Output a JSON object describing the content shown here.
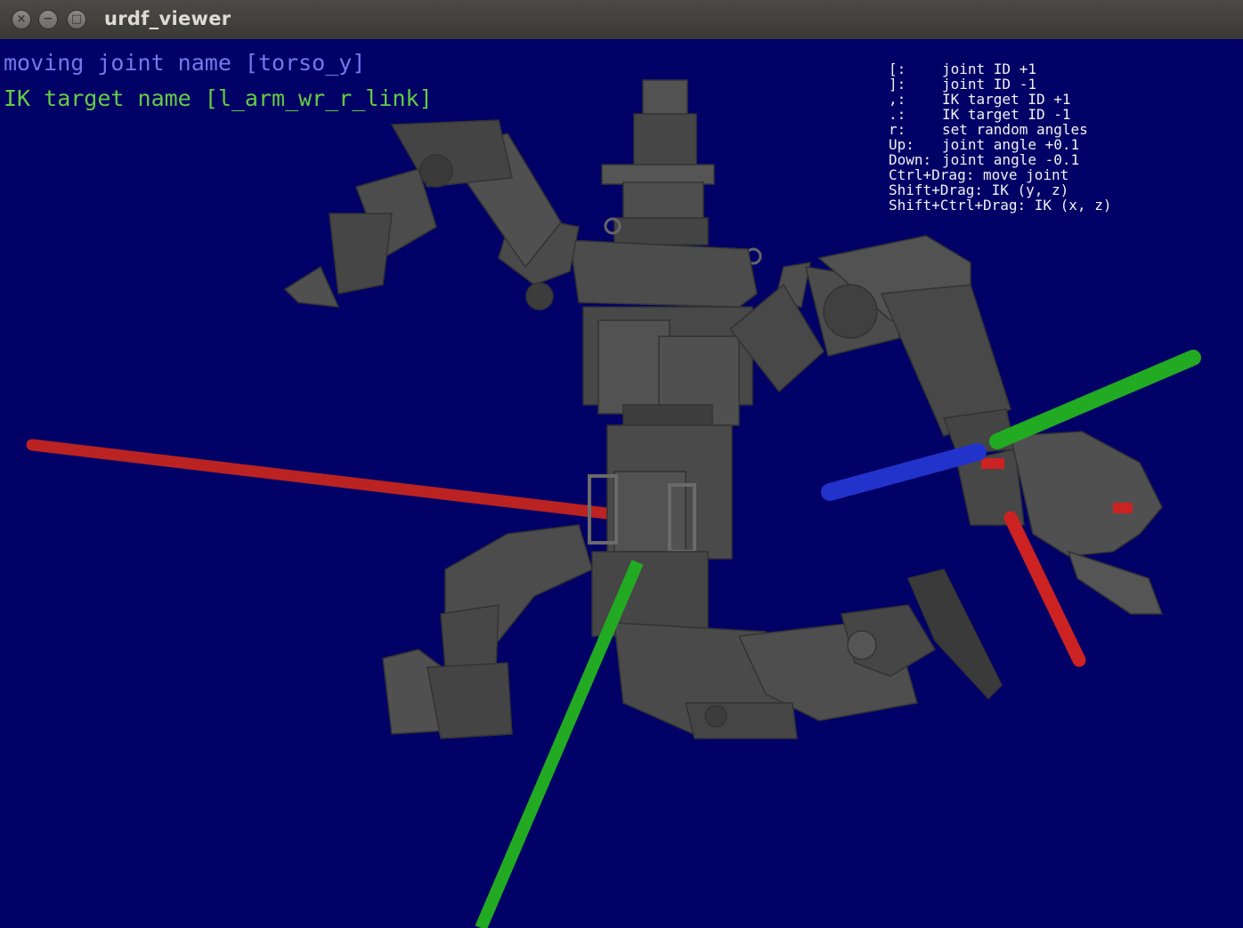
{
  "window": {
    "title": "urdf_viewer",
    "buttons": [
      {
        "name": "close",
        "glyph": "×"
      },
      {
        "name": "minimize",
        "glyph": "−"
      },
      {
        "name": "maximize",
        "glyph": "□"
      }
    ]
  },
  "status": {
    "moving_joint": "moving joint name [torso_y]",
    "ik_target": "IK target name [l_arm_wr_r_link]"
  },
  "help": {
    "rows": [
      {
        "key": "[:",
        "desc": "joint ID +1"
      },
      {
        "key": "]:",
        "desc": "joint ID -1"
      },
      {
        "key": ",:",
        "desc": "IK target ID +1"
      },
      {
        "key": ".:",
        "desc": "IK target ID -1"
      },
      {
        "key": "r:",
        "desc": "set random angles"
      },
      {
        "key": "Up:",
        "desc": "joint angle +0.1"
      },
      {
        "key": "Down:",
        "desc": "joint angle -0.1"
      }
    ],
    "lines": [
      "Ctrl+Drag: move joint",
      "Shift+Drag: IK (y, z)",
      "Shift+Ctrl+Drag: IK (x, z)"
    ]
  },
  "colors": {
    "background": "#000066",
    "robot": "#4a4a4a",
    "axis_x": "#cc2222",
    "axis_y": "#22aa22",
    "axis_z": "#2233cc",
    "moving_joint_text": "#7777ee",
    "ik_target_text": "#66cc44"
  }
}
